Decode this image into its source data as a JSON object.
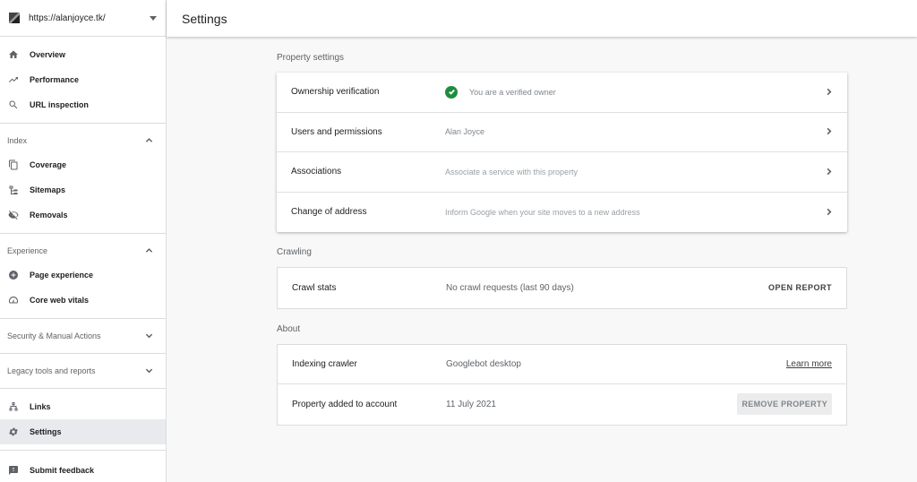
{
  "sidebar": {
    "property_url": "https://alanjoyce.tk/",
    "top_items": [
      {
        "label": "Overview",
        "icon": "home-icon"
      },
      {
        "label": "Performance",
        "icon": "trending-up-icon"
      },
      {
        "label": "URL inspection",
        "icon": "search-icon"
      }
    ],
    "index": {
      "heading": "Index",
      "items": [
        {
          "label": "Coverage",
          "icon": "coverage-icon"
        },
        {
          "label": "Sitemaps",
          "icon": "sitemap-icon"
        },
        {
          "label": "Removals",
          "icon": "eye-off-icon"
        }
      ]
    },
    "experience": {
      "heading": "Experience",
      "items": [
        {
          "label": "Page experience",
          "icon": "plus-circle-icon"
        },
        {
          "label": "Core web vitals",
          "icon": "gauge-icon"
        }
      ]
    },
    "security_heading": "Security & Manual Actions",
    "legacy_heading": "Legacy tools and reports",
    "bottom_items": [
      {
        "label": "Links",
        "icon": "links-icon"
      },
      {
        "label": "Settings",
        "icon": "gear-icon"
      }
    ],
    "feedback": {
      "label": "Submit feedback",
      "icon": "feedback-icon"
    }
  },
  "header": {
    "title": "Settings"
  },
  "property_settings": {
    "title": "Property settings",
    "rows": [
      {
        "label": "Ownership verification",
        "value": "You are a verified owner"
      },
      {
        "label": "Users and permissions",
        "value": "Alan Joyce"
      },
      {
        "label": "Associations",
        "value": "Associate a service with this property"
      },
      {
        "label": "Change of address",
        "value": "Inform Google when your site moves to a new address"
      }
    ]
  },
  "crawling": {
    "title": "Crawling",
    "row": {
      "label": "Crawl stats",
      "value": "No crawl requests (last 90 days)",
      "action": "OPEN REPORT"
    }
  },
  "about": {
    "title": "About",
    "rows": [
      {
        "label": "Indexing crawler",
        "value": "Googlebot desktop",
        "action": "Learn more"
      },
      {
        "label": "Property added to account",
        "value": "11 July 2021",
        "action": "REMOVE PROPERTY"
      }
    ]
  },
  "colors": {
    "verified_green": "#1e8e3e",
    "active_nav_bg": "#e8eaed"
  }
}
